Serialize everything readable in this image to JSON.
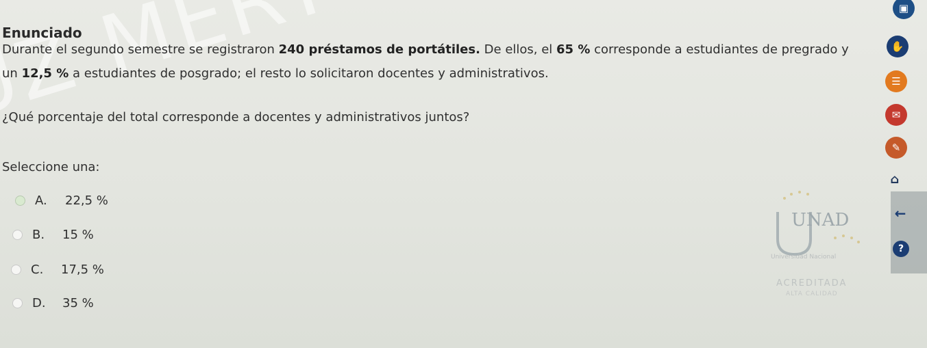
{
  "question": {
    "heading": "Enunciado",
    "statement": {
      "p1_before": "Durante el segundo semestre se registraron ",
      "p1_bold": "240 préstamos de portátiles.",
      "p1_mid": " De ellos, el ",
      "p1_pct": "65 %",
      "p1_after": " corresponde a estudiantes de pregrado y",
      "p2_before": "un ",
      "p2_pct": "12,5 %",
      "p2_after": " a estudiantes de posgrado; el resto lo solicitaron docentes y administrativos."
    },
    "prompt": "¿Qué porcentaje del total corresponde a docentes y administrativos juntos?",
    "select_label": "Seleccione una:",
    "options": [
      {
        "letter": "A.",
        "text": "22,5 %",
        "selected": true
      },
      {
        "letter": "B.",
        "text": "15 %",
        "selected": false
      },
      {
        "letter": "C.",
        "text": "17,5 %",
        "selected": false
      },
      {
        "letter": "D.",
        "text": "35 %",
        "selected": false
      }
    ]
  },
  "watermark": "LUZ MERY CHAMORRO GOMEZ",
  "logo": {
    "letters": "UNAD",
    "caption": "Universidad Nacional",
    "accredited": "ACREDITADA",
    "quality": "ALTA CALIDAD"
  },
  "sidebar": {
    "icons": [
      "image-icon",
      "hand-icon",
      "document-icon",
      "mail-icon",
      "edit-icon",
      "home-icon",
      "back-arrow-icon",
      "help-icon"
    ],
    "colors": {
      "blue": "#1b4e8f",
      "orange": "#e07b1d",
      "red": "#c43a2f",
      "navy": "#23395d"
    }
  }
}
